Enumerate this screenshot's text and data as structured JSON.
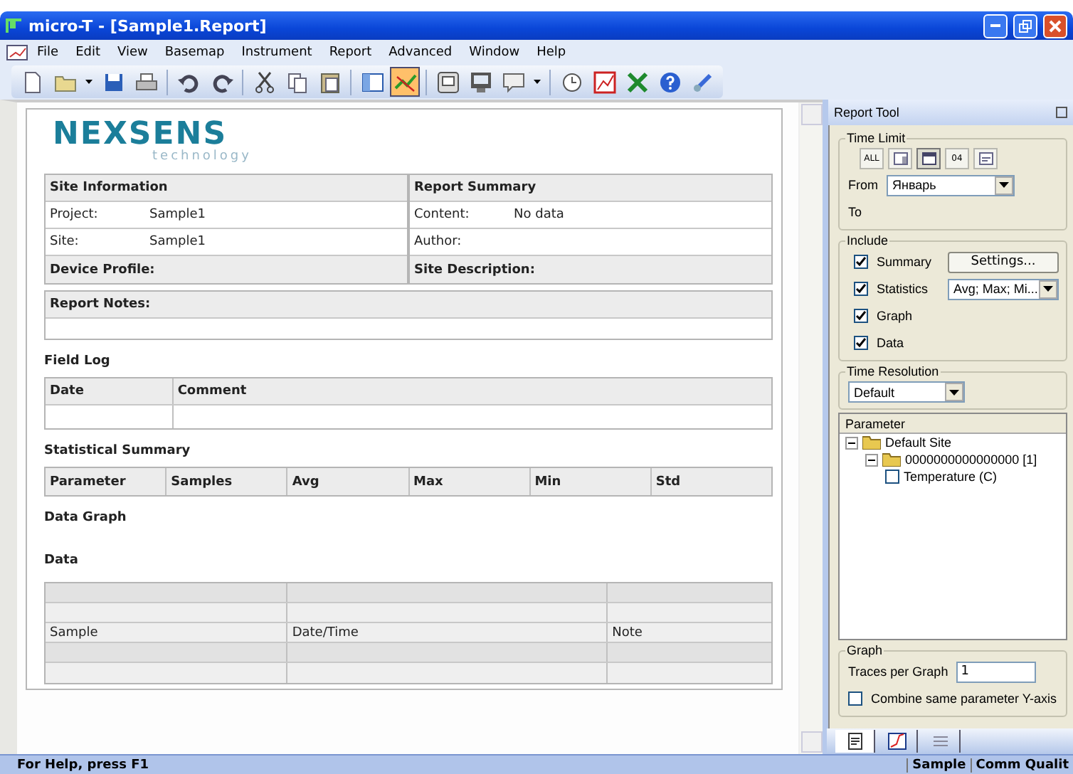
{
  "window": {
    "title": "micro-T - [Sample1.Report]"
  },
  "menu": [
    {
      "label": "File"
    },
    {
      "label": "Edit"
    },
    {
      "label": "View"
    },
    {
      "label": "Basemap"
    },
    {
      "label": "Instrument"
    },
    {
      "label": "Report"
    },
    {
      "label": "Advanced"
    },
    {
      "label": "Window"
    },
    {
      "label": "Help"
    }
  ],
  "toolbar": [
    {
      "kind": "new",
      "selected": false
    },
    {
      "kind": "open",
      "selected": false
    },
    {
      "kind": "dropdown",
      "selected": false
    },
    {
      "kind": "save",
      "selected": false
    },
    {
      "kind": "print",
      "selected": false
    },
    {
      "kind": "sep"
    },
    {
      "kind": "undo",
      "selected": false
    },
    {
      "kind": "redo",
      "selected": false
    },
    {
      "kind": "sep"
    },
    {
      "kind": "cut",
      "selected": false
    },
    {
      "kind": "copy",
      "selected": false
    },
    {
      "kind": "paste",
      "selected": false
    },
    {
      "kind": "sep"
    },
    {
      "kind": "panel",
      "selected": false
    },
    {
      "kind": "chart",
      "selected": true
    },
    {
      "kind": "sep"
    },
    {
      "kind": "device",
      "selected": false
    },
    {
      "kind": "monitor",
      "selected": false
    },
    {
      "kind": "message",
      "selected": false
    },
    {
      "kind": "dropdown",
      "selected": false
    },
    {
      "kind": "sep"
    },
    {
      "kind": "clock",
      "selected": false
    },
    {
      "kind": "graph",
      "selected": false
    },
    {
      "kind": "excel",
      "selected": false
    },
    {
      "kind": "help",
      "selected": false
    },
    {
      "kind": "connect",
      "selected": false
    }
  ],
  "report": {
    "logo": {
      "name": "NEXSENS",
      "tagline": "technology"
    },
    "site_information": {
      "title": "Site Information",
      "rows": [
        {
          "label": "Project:",
          "value": "Sample1"
        },
        {
          "label": "Site:",
          "value": "Sample1"
        }
      ],
      "footer": "Device Profile:"
    },
    "report_summary": {
      "title": "Report Summary",
      "rows": [
        {
          "label": "Content:",
          "value": "No data"
        },
        {
          "label": "Author:"
        }
      ],
      "footer": "Site Description:"
    },
    "notes_title": "Report Notes:",
    "field_log": {
      "title": "Field Log",
      "columns": [
        "Date",
        "Comment"
      ]
    },
    "statistical_summary": {
      "title": "Statistical Summary",
      "columns": [
        "Parameter",
        "Samples",
        "Avg",
        "Max",
        "Min",
        "Std"
      ]
    },
    "data_graph_title": "Data Graph",
    "data": {
      "title": "Data",
      "label_row": [
        "Sample",
        "Date/Time",
        "Note"
      ]
    }
  },
  "report_tool": {
    "title": "Report Tool",
    "time_limit": {
      "title": "Time Limit",
      "buttons": [
        {
          "kind": "all",
          "label": "ALL",
          "selected": false
        },
        {
          "kind": "week",
          "selected": false
        },
        {
          "kind": "month",
          "selected": true
        },
        {
          "kind": "day",
          "label": "04",
          "selected": false
        },
        {
          "kind": "range",
          "selected": false
        }
      ],
      "from_label": "From",
      "from_value": "Январь",
      "to_label": "To"
    },
    "include": {
      "title": "Include",
      "items": [
        {
          "label": "Summary",
          "checked": true,
          "kind": "button",
          "control": "Settings..."
        },
        {
          "label": "Statistics",
          "checked": true,
          "kind": "select",
          "control": "Avg; Max; Mi..."
        },
        {
          "label": "Graph",
          "checked": true
        },
        {
          "label": "Data",
          "checked": true
        }
      ]
    },
    "time_resolution": {
      "title": "Time Resolution",
      "value": "Default"
    },
    "parameter": {
      "title": "Parameter",
      "tree": [
        {
          "label": "Default Site",
          "expanded": true,
          "children": [
            {
              "label": "0000000000000000 [1]",
              "expanded": true,
              "children": [
                {
                  "label": "Temperature (C)",
                  "checked": false
                }
              ]
            }
          ]
        }
      ]
    },
    "graph": {
      "title": "Graph",
      "traces_label": "Traces per Graph",
      "traces_value": "1",
      "combine_label": "Combine same parameter Y-axis",
      "combine_checked": false
    },
    "tabs": [
      {
        "kind": "report",
        "selected": true
      },
      {
        "kind": "graph",
        "selected": false
      },
      {
        "kind": "list",
        "selected": false
      }
    ]
  },
  "status_bar": {
    "help": "For Help, press F1",
    "panes": [
      "Sample",
      "Comm Qualit"
    ]
  }
}
